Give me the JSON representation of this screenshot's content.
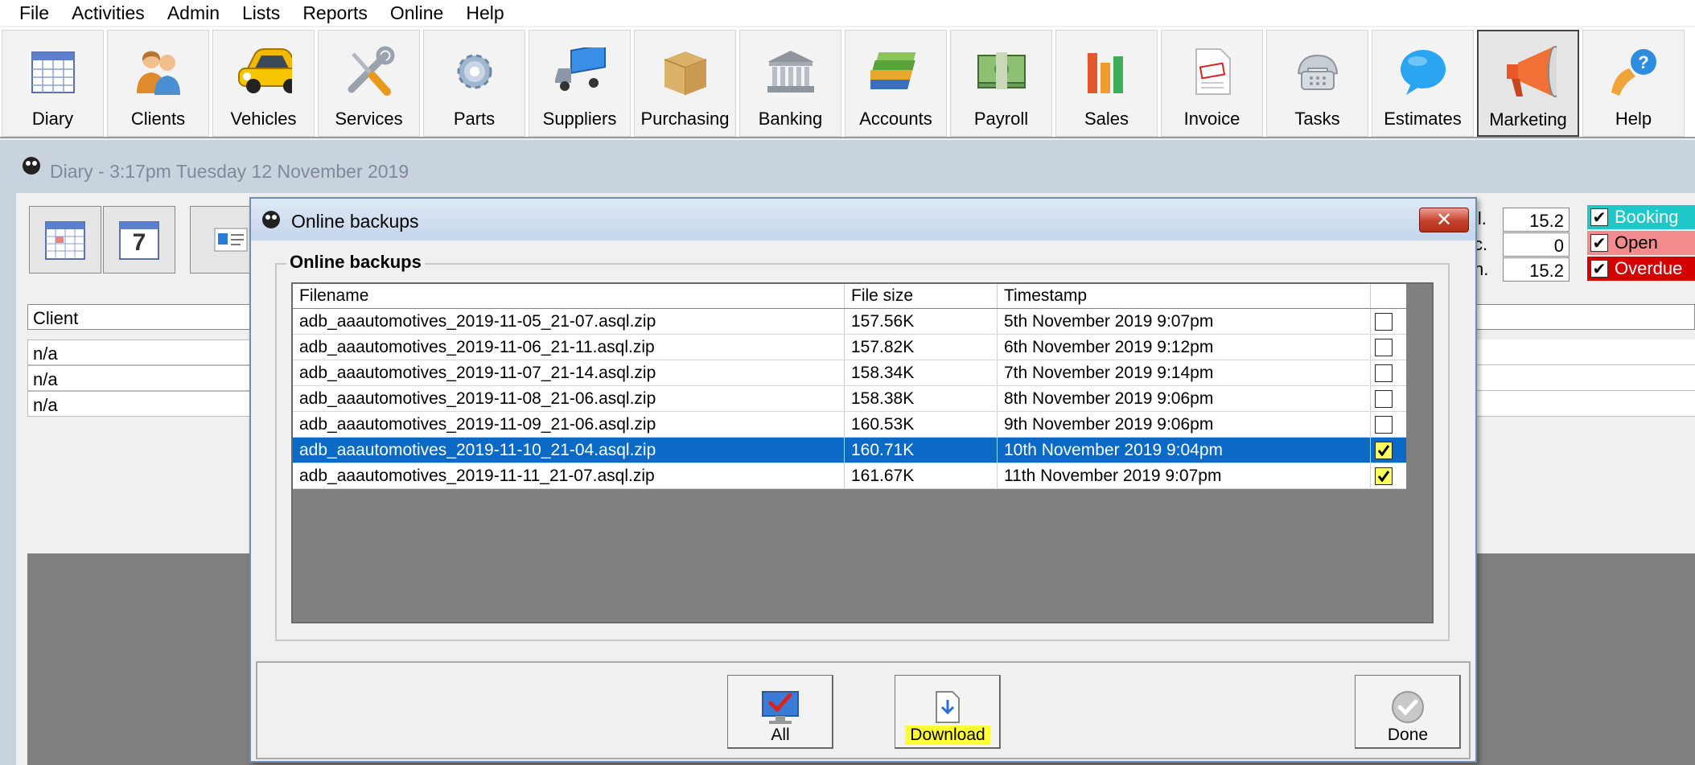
{
  "menubar": [
    "File",
    "Activities",
    "Admin",
    "Lists",
    "Reports",
    "Online",
    "Help"
  ],
  "toolbar": [
    {
      "label": "Diary",
      "icon": "calendar-icon"
    },
    {
      "label": "Clients",
      "icon": "people-icon"
    },
    {
      "label": "Vehicles",
      "icon": "car-icon"
    },
    {
      "label": "Services",
      "icon": "tools-icon"
    },
    {
      "label": "Parts",
      "icon": "gear-icon"
    },
    {
      "label": "Suppliers",
      "icon": "truck-icon"
    },
    {
      "label": "Purchasing",
      "icon": "box-icon"
    },
    {
      "label": "Banking",
      "icon": "bank-icon"
    },
    {
      "label": "Accounts",
      "icon": "books-icon"
    },
    {
      "label": "Payroll",
      "icon": "money-icon"
    },
    {
      "label": "Sales",
      "icon": "bar-chart-icon"
    },
    {
      "label": "Invoice",
      "icon": "invoice-icon"
    },
    {
      "label": "Tasks",
      "icon": "phone-icon"
    },
    {
      "label": "Estimates",
      "icon": "speech-bubble-icon"
    },
    {
      "label": "Marketing",
      "icon": "megaphone-icon",
      "active": true
    },
    {
      "label": "Help",
      "icon": "help-icon"
    }
  ],
  "diary": {
    "title": "Diary - 3:17pm Tuesday 12 November 2019",
    "client_header": "Client",
    "client_rows": [
      "n/a",
      "n/a",
      "n/a"
    ],
    "side_labels": [
      "il.",
      "c.",
      "n."
    ],
    "side_values": [
      "15.2",
      "0",
      "15.2"
    ],
    "legend": [
      {
        "label": "Booking",
        "color": "#1fc8c8",
        "text_color": "#ffffff"
      },
      {
        "label": "Open",
        "color": "#f28b8b",
        "text_color": "#000000"
      },
      {
        "label": "Overdue",
        "color": "#d40000",
        "text_color": "#ffffff"
      }
    ],
    "calendar_day": "7"
  },
  "dialog": {
    "title": "Online backups",
    "group_title": "Online backups",
    "columns": [
      "Filename",
      "File size",
      "Timestamp"
    ],
    "rows": [
      {
        "filename": "adb_aaautomotives_2019-11-05_21-07.asql.zip",
        "size": "157.56K",
        "timestamp": "5th November 2019 9:07pm",
        "checked": false,
        "selected": false
      },
      {
        "filename": "adb_aaautomotives_2019-11-06_21-11.asql.zip",
        "size": "157.82K",
        "timestamp": "6th November 2019 9:12pm",
        "checked": false,
        "selected": false
      },
      {
        "filename": "adb_aaautomotives_2019-11-07_21-14.asql.zip",
        "size": "158.34K",
        "timestamp": "7th November 2019 9:14pm",
        "checked": false,
        "selected": false
      },
      {
        "filename": "adb_aaautomotives_2019-11-08_21-06.asql.zip",
        "size": "158.38K",
        "timestamp": "8th November 2019 9:06pm",
        "checked": false,
        "selected": false
      },
      {
        "filename": "adb_aaautomotives_2019-11-09_21-06.asql.zip",
        "size": "160.53K",
        "timestamp": "9th November 2019 9:06pm",
        "checked": false,
        "selected": false
      },
      {
        "filename": "adb_aaautomotives_2019-11-10_21-04.asql.zip",
        "size": "160.71K",
        "timestamp": "10th November 2019 9:04pm",
        "checked": true,
        "selected": true
      },
      {
        "filename": "adb_aaautomotives_2019-11-11_21-07.asql.zip",
        "size": "161.67K",
        "timestamp": "11th November 2019 9:07pm",
        "checked": true,
        "selected": false
      }
    ],
    "buttons": {
      "all": "All",
      "download": "Download",
      "done": "Done"
    },
    "download_highlight": "#ffff33"
  }
}
